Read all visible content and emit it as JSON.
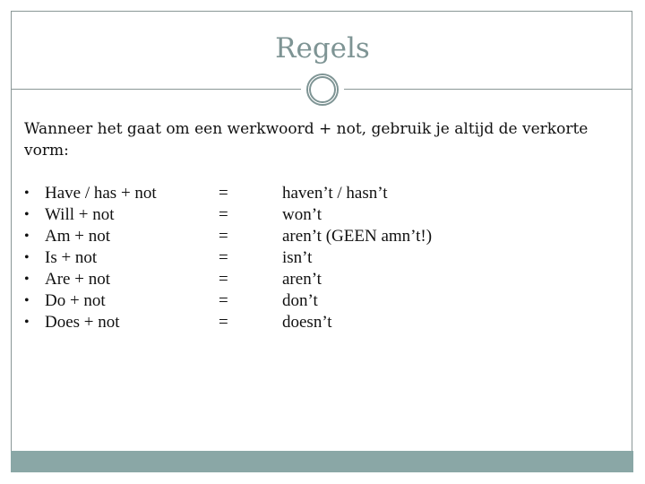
{
  "slide": {
    "title": "Regels",
    "intro": "Wanneer het gaat om een werkwoord + not, gebruik je altijd de verkorte vorm:",
    "rules": [
      {
        "bullet": "•",
        "lhs": "Have / has + not",
        "eq": "=",
        "rhs": "haven’t / hasn’t"
      },
      {
        "bullet": "•",
        "lhs": "Will + not",
        "eq": "=",
        "rhs": "won’t"
      },
      {
        "bullet": "•",
        "lhs": "Am + not",
        "eq": "=",
        "rhs": "aren’t (GEEN amn’t!)"
      },
      {
        "bullet": "•",
        "lhs": "Is + not",
        "eq": "=",
        "rhs": "isn’t"
      },
      {
        "bullet": "•",
        "lhs": "Are + not",
        "eq": "=",
        "rhs": "aren’t"
      },
      {
        "bullet": "•",
        "lhs": "Do + not",
        "eq": "=",
        "rhs": "don’t"
      },
      {
        "bullet": "•",
        "lhs": "Does + not",
        "eq": "=",
        "rhs": "doesn’t"
      }
    ]
  },
  "theme": {
    "accent": "#7e9494",
    "border": "#8a9796",
    "footer_bar": "#8aa7a6",
    "text": "#111111"
  },
  "icons": {
    "ornament": "double-ring-circle-icon"
  }
}
